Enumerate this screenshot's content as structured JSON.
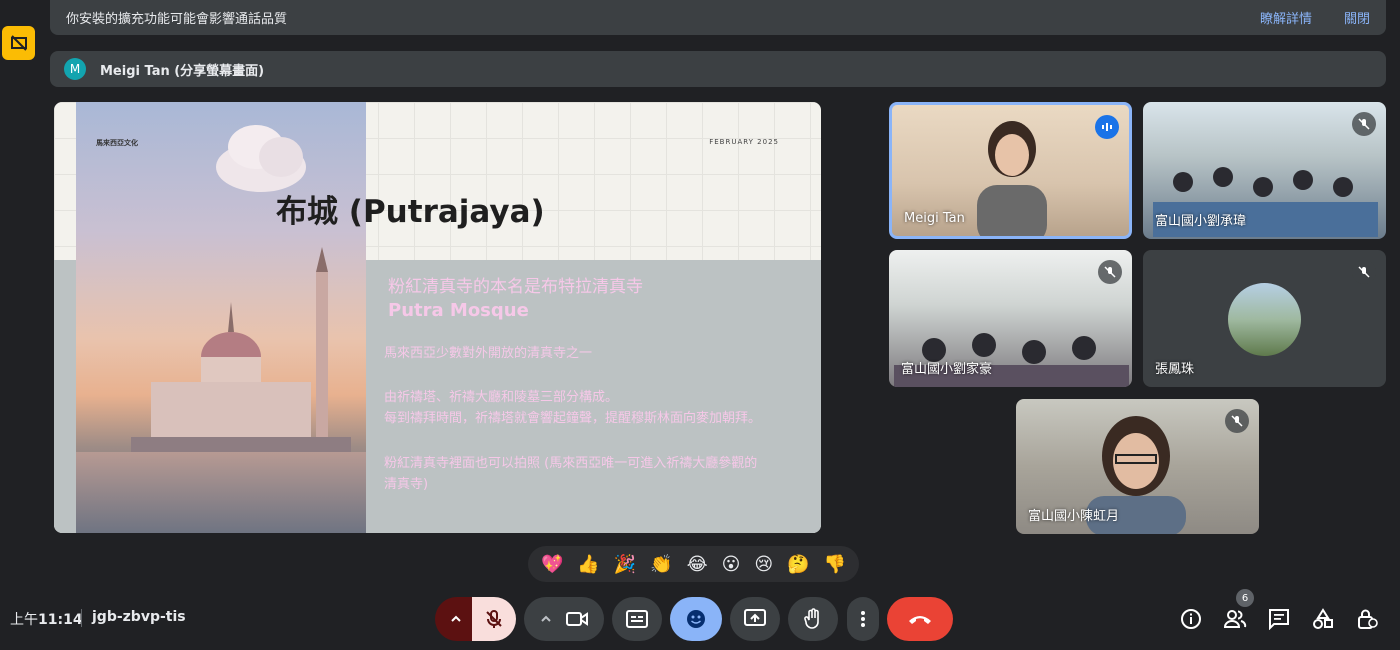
{
  "notice": {
    "message": "你安裝的擴充功能可能會影響通話品質",
    "learn_more": "瞭解詳情",
    "close": "關閉"
  },
  "presenter": {
    "avatar_letter": "M",
    "label": "Meigi Tan (分享螢幕畫面)"
  },
  "slide": {
    "top_left": "馬來西亞文化",
    "top_right": "FEBRUARY 2025",
    "title": "布城 (Putrajaya)",
    "subtitle_cn": "粉紅清真寺的本名是布特拉清真寺",
    "subtitle_en": "Putra Mosque",
    "line1": "馬來西亞少數對外開放的清真寺之一",
    "line2": "由祈禱塔、祈禱大廳和陵墓三部分構成。",
    "line3": "每到禱拜時間，祈禱塔就會響起鐘聲，提醒穆斯林面向麥加朝拜。",
    "line4": "粉紅清真寺裡面也可以拍照 (馬來西亞唯一可進入祈禱大廳參觀的清真寺)",
    "line4a": "粉紅清真寺裡面也可以拍照 (馬來西亞唯一可進入祈禱大廳參觀的",
    "line4b": "清真寺)"
  },
  "participants": [
    {
      "name": "Meigi Tan",
      "state": "speaking"
    },
    {
      "name": "富山國小劉承瑋",
      "state": "muted"
    },
    {
      "name": "富山國小劉家豪",
      "state": "muted"
    },
    {
      "name": "張鳳珠",
      "state": "muted"
    },
    {
      "name": "富山國小陳虹月",
      "state": "muted"
    }
  ],
  "reactions": [
    "💖",
    "👍",
    "🎉",
    "👏",
    "😂",
    "😮",
    "😢",
    "🤔",
    "👎"
  ],
  "footer": {
    "time_prefix": "上午",
    "time": "11:14",
    "meeting_code": "jgb-zbvp-tis",
    "people_count": "6"
  },
  "colors": {
    "background": "#202124",
    "end_call": "#ea4335",
    "accent": "#8ab4f8",
    "warning_badge": "#fbbc04"
  }
}
